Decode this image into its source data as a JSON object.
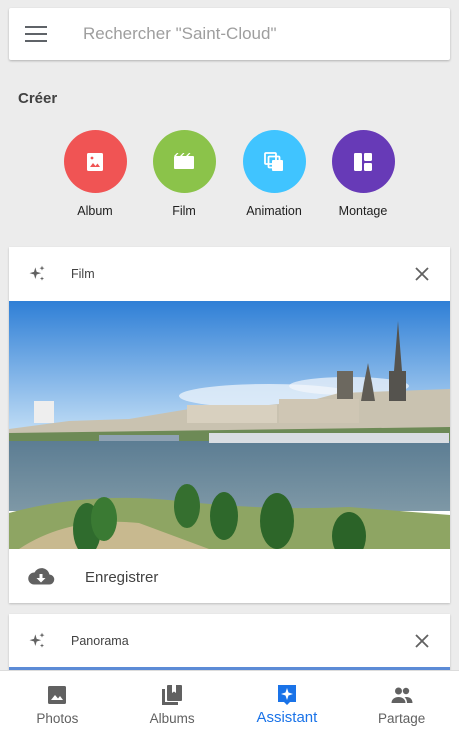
{
  "search": {
    "placeholder": "Rechercher \"Saint-Cloud\"",
    "menu_icon": "menu-icon",
    "search_value": ""
  },
  "create": {
    "title": "Créer",
    "items": [
      {
        "label": "Album",
        "icon": "photo-album-icon",
        "color": "#f05454"
      },
      {
        "label": "Film",
        "icon": "movie-icon",
        "color": "#8bc34a"
      },
      {
        "label": "Animation",
        "icon": "animation-icon",
        "color": "#40c4ff"
      },
      {
        "label": "Montage",
        "icon": "collage-icon",
        "color": "#673ab7"
      }
    ]
  },
  "cards": [
    {
      "title": "Film",
      "icon": "sparkle-icon",
      "close_icon": "close-icon",
      "action_label": "Enregistrer",
      "action_icon": "cloud-download-icon"
    },
    {
      "title": "Panorama",
      "icon": "sparkle-icon",
      "close_icon": "close-icon"
    }
  ],
  "bottom_nav": {
    "active": "Assistant",
    "accent": "#1a73e8",
    "items": [
      {
        "label": "Photos",
        "icon": "photo-icon"
      },
      {
        "label": "Albums",
        "icon": "albums-icon"
      },
      {
        "label": "Assistant",
        "icon": "assistant-icon"
      },
      {
        "label": "Partage",
        "icon": "people-icon"
      }
    ]
  }
}
